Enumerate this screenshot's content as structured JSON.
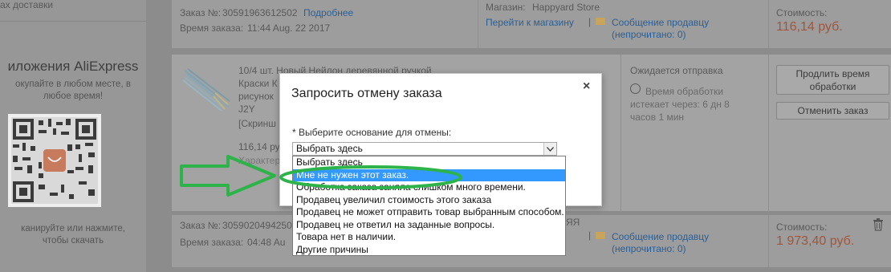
{
  "left": {
    "delivery_text": "ах доставки",
    "app_title": "иложения AliExpress",
    "app_sub1": "окупайте в любом месте, в",
    "app_sub2": "любое время!",
    "qr_label": "AliExpress",
    "scan_line1": "канируйте или нажмите,",
    "scan_line2": "чтобы скачать"
  },
  "order1": {
    "order_no_label": "Заказ №:",
    "order_no": "30591963612502",
    "details_link": "Подробнее",
    "time_label": "Время заказа:",
    "time": "11:44 Aug. 22 2017",
    "store_label": "Магазин:",
    "store": "Happyard Store",
    "goto_store": "Перейти к магазину",
    "message_seller": "Сообщение продавцу",
    "unread": "(непрочитано: 0)",
    "cost_label": "Стоимость:",
    "cost": "116,14 руб."
  },
  "item": {
    "title_line1": "10/4 шт. Новый Нейлон деревянной ручкой",
    "title_line2": "Краски К",
    "title_line3": "рисунок",
    "title_line4": "J2Y",
    "screenshot": "[Скринш",
    "price": "116,14 руб",
    "chars": "Характер",
    "status": "Ожидается отправка",
    "processing_line1": "Время обработки",
    "processing_line2": "истекает через: 6 дн 8",
    "processing_line3": "часов 1 мин",
    "extend_btn_line1": "Продлить время",
    "extend_btn_line2": "обработки",
    "cancel_btn": "Отменить заказ"
  },
  "order2": {
    "order_no_label": "Заказ №:",
    "order_no": "3059020494250",
    "time_label": "Время заказа:",
    "time": "04:48 Au",
    "store_fragment": "ЯЯ",
    "message_seller": "Сообщение продавцу",
    "unread": "(непрочитано: 0)",
    "cost_label": "Стоимость:",
    "cost": "1 973,40 руб."
  },
  "modal": {
    "title": "Запросить отмену заказа",
    "close": "×",
    "label": "* Выберите основание для отмены:",
    "select_value": "Выбрать здесь",
    "options": [
      "Выбрать здесь",
      "Мне не нужен этот заказ.",
      "Обработка заказа заняла слишком много времени.",
      "Продавец увеличил стоимость этого заказа",
      "Продавец не может отправить товар выбранным способом.",
      "Продавец не ответил на заданные вопросы.",
      "Товара нет в наличии.",
      "Другие причины"
    ],
    "selected_index": 1
  },
  "colors": {
    "highlight": "#3399ff",
    "annotation": "#2db34a"
  }
}
